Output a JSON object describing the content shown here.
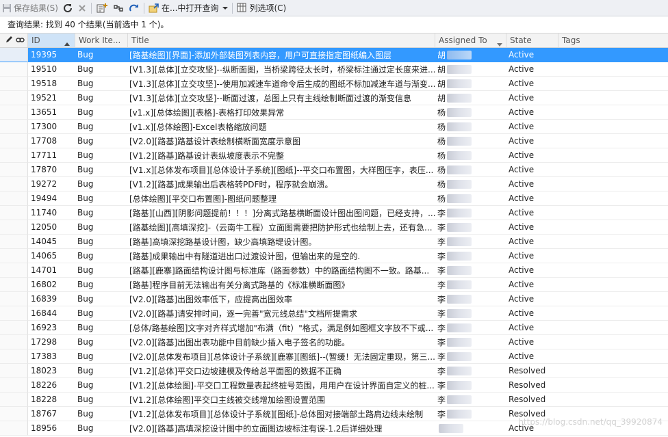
{
  "toolbar": {
    "save_label": "保存结果(S)",
    "open_in_label": "在...中打开查询",
    "column_options_label": "列选项(C)"
  },
  "summary": "查询结果: 找到 40 个结果(当前选中 1 个)。",
  "columns": {
    "id": "ID",
    "work_item": "Work Ite...",
    "title": "Title",
    "assigned_to": "Assigned To",
    "state": "State",
    "tags": "Tags"
  },
  "sort": {
    "column": "ID",
    "direction": "ascending"
  },
  "rows": [
    {
      "id": "19395",
      "type": "Bug",
      "title": "[路基绘图][界面]-添加外部装图列表内容，用户可直接指定图纸编入图层",
      "assigned": "胡",
      "state": "Active"
    },
    {
      "id": "19510",
      "type": "Bug",
      "title": "[V1.3][总体][立交攻坚]--纵断面图，当桥梁跨径太长时，桥梁标注通过定长度来进...",
      "assigned": "胡",
      "state": "Active"
    },
    {
      "id": "19518",
      "type": "Bug",
      "title": "[V1.3][总体][立交攻坚]--使用加减速车道命令后生成的图纸不标加减速车道与渐变...",
      "assigned": "胡",
      "state": "Active"
    },
    {
      "id": "19521",
      "type": "Bug",
      "title": "[V1.3][总体][立交攻坚]--断面过渡，总图上只有主线绘制断面过渡的渐变信息",
      "assigned": "胡",
      "state": "Active"
    },
    {
      "id": "13651",
      "type": "Bug",
      "title": "[v1.x][总体绘图][表格]-表格打印效果异常",
      "assigned": "杨",
      "state": "Active"
    },
    {
      "id": "17300",
      "type": "Bug",
      "title": "[v1.x][总体绘图]-Excel表格缩放问题",
      "assigned": "杨",
      "state": "Active"
    },
    {
      "id": "17708",
      "type": "Bug",
      "title": "[V2.0][路基]路基设计表绘制横断面宽度示意图",
      "assigned": "杨",
      "state": "Active"
    },
    {
      "id": "17711",
      "type": "Bug",
      "title": "[V1.2][路基]路基设计表纵坡度表示不完整",
      "assigned": "杨",
      "state": "Active"
    },
    {
      "id": "17870",
      "type": "Bug",
      "title": "[V1.x][总体发布项目][总体设计子系统][图纸]--平交口布置图，大样图压字，表压...",
      "assigned": "杨",
      "state": "Active"
    },
    {
      "id": "19272",
      "type": "Bug",
      "title": "[V1.2][路基]成果输出后表格转PDF时，程序就会崩溃。",
      "assigned": "杨",
      "state": "Active"
    },
    {
      "id": "19494",
      "type": "Bug",
      "title": "[总体绘图][平交口布置图]-图纸问题整理",
      "assigned": "杨",
      "state": "Active"
    },
    {
      "id": "11740",
      "type": "Bug",
      "title": "[路基][山西][阴影问题提前！！！]分离式路基横断面设计图出图问题，已经支持，...",
      "assigned": "李",
      "state": "Active"
    },
    {
      "id": "12050",
      "type": "Bug",
      "title": "[路基绘图][高填深挖]-（云南牛工程）立面图需要把防护形式也绘制上去，还有急...",
      "assigned": "李",
      "state": "Active"
    },
    {
      "id": "14045",
      "type": "Bug",
      "title": "[路基]高填深挖路基设计图，缺少高填路堤设计图。",
      "assigned": "李",
      "state": "Active"
    },
    {
      "id": "14065",
      "type": "Bug",
      "title": "[路基]成果输出中有隧道进出口过渡设计图，但输出来的是空的.",
      "assigned": "李",
      "state": "Active"
    },
    {
      "id": "14701",
      "type": "Bug",
      "title": "[路基][鹿寨]路面结构设计图与标准库（路面参数）中的路面结构图不一致。路基...",
      "assigned": "李",
      "state": "Active"
    },
    {
      "id": "16802",
      "type": "Bug",
      "title": "[路基]程序目前无法输出有关分离式路基的《标准横断面图》",
      "assigned": "李",
      "state": "Active"
    },
    {
      "id": "16839",
      "type": "Bug",
      "title": "[V2.0][路基]出图效率低下，应提高出图效率",
      "assigned": "李",
      "state": "Active"
    },
    {
      "id": "16844",
      "type": "Bug",
      "title": "[V2.0][路基]请安排时间，逐一完善\"宽元线总结\"文档所提需求",
      "assigned": "李",
      "state": "Active"
    },
    {
      "id": "16923",
      "type": "Bug",
      "title": "[总体/路基绘图]文字对齐样式增加\"布满（fit）\"格式，满足例如图框文字放不下或...",
      "assigned": "李",
      "state": "Active"
    },
    {
      "id": "17298",
      "type": "Bug",
      "title": "[V2.0][路基]出图出表功能中目前缺少插入电子签名的功能。",
      "assigned": "李",
      "state": "Active"
    },
    {
      "id": "17383",
      "type": "Bug",
      "title": "[V2.0][总体发布项目][总体设计子系统][鹿寨][图纸]--(暂缓！无法固定重现，第三...",
      "assigned": "李",
      "state": "Active"
    },
    {
      "id": "18023",
      "type": "Bug",
      "title": "[V1.2][总体]平交口边坡建模及传给总平面图的数据不正确",
      "assigned": "李",
      "state": "Resolved"
    },
    {
      "id": "18226",
      "type": "Bug",
      "title": "[V1.2][总体绘图]-平交口工程数量表起终桩号范围，用用户在设计界面自定义的桩...",
      "assigned": "李",
      "state": "Resolved"
    },
    {
      "id": "18228",
      "type": "Bug",
      "title": "[V1.2][总体绘图]平交口主线被交线增加绘图设置范围",
      "assigned": "李",
      "state": "Resolved"
    },
    {
      "id": "18767",
      "type": "Bug",
      "title": "[V1.2][总体发布项目][总体设计子系统][图纸]-总体图对接端部土路肩边线未绘制",
      "assigned": "李",
      "state": "Resolved"
    },
    {
      "id": "18956",
      "type": "Bug",
      "title": "[V2.0][路基]高填深挖设计图中的立面图边坡标注有误-1.2后详细处理",
      "assigned": "",
      "state": "Active"
    }
  ],
  "selected_row_index": 0,
  "watermark": "https://blog.csdn.net/qq_39920874",
  "colors": {
    "selection": "#3399ff",
    "header_sorted": "#cfe3f7",
    "toolbar": "#eef0f4"
  }
}
